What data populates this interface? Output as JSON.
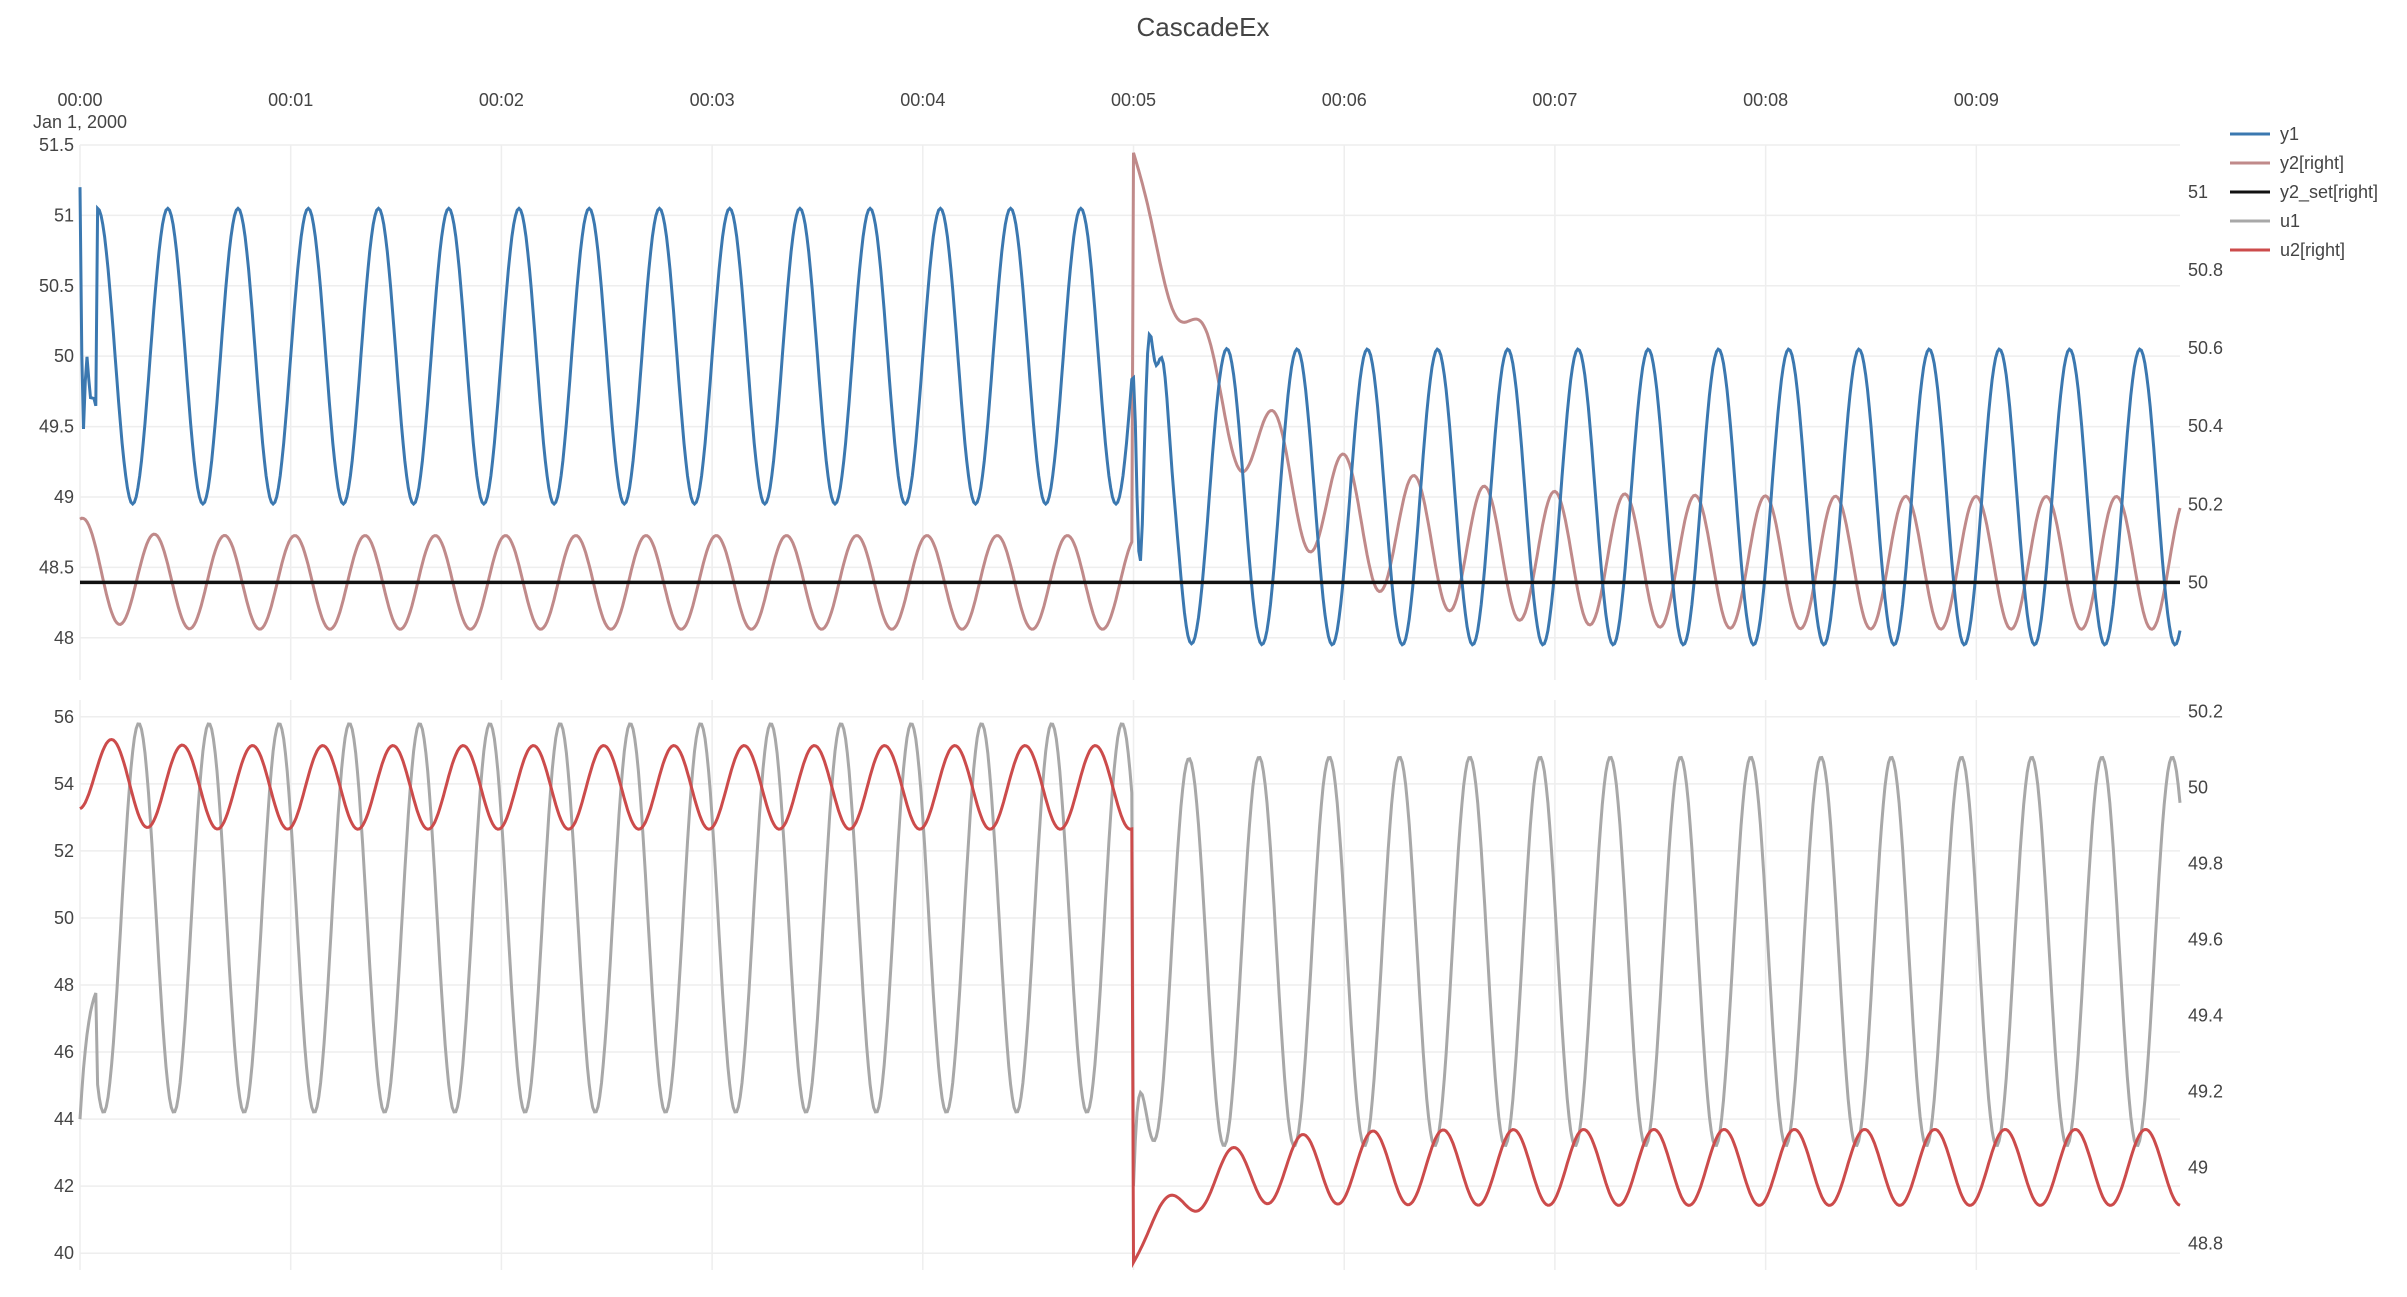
{
  "chart_data": {
    "type": "line",
    "title": "CascadeEx",
    "x_tick_labels": [
      "00:00",
      "00:01",
      "00:02",
      "00:03",
      "00:04",
      "00:05",
      "00:06",
      "00:07",
      "00:08",
      "00:09"
    ],
    "x_date_label": "Jan 1, 2000",
    "x_range_seconds": [
      0,
      598
    ],
    "grid": true,
    "legend_position": "top-right",
    "colors": {
      "y1": "#3b78b0",
      "y2": "#c08a8a",
      "y2_set": "#111111",
      "u1": "#a8a8a8",
      "u2": "#cc4b4b"
    },
    "series": [
      {
        "name": "y1",
        "subplot": "top",
        "axis": "left",
        "description": "oscillation ~49-51 before 00:05, ~48-50 after"
      },
      {
        "name": "y2[right]",
        "subplot": "top",
        "axis": "right",
        "description": "oscillation ~49.9-50.1 before 00:05, spike to 51.1 then decays"
      },
      {
        "name": "y2_set[right]",
        "subplot": "top",
        "axis": "right",
        "constant": 50
      },
      {
        "name": "u1",
        "subplot": "bottom",
        "axis": "left",
        "description": "oscillation ~44-56 before 00:05, ~43-55 after"
      },
      {
        "name": "u2[right]",
        "subplot": "bottom",
        "axis": "right",
        "description": "oscillation ~49.9-50.1 before 00:05, drops to ~48.9-49.1 after"
      }
    ],
    "subplots": [
      {
        "id": "top",
        "left_axis": {
          "range": [
            47.7,
            51.5
          ],
          "ticks": [
            "51.5",
            "51",
            "50.5",
            "50",
            "49.5",
            "49",
            "48.5",
            "48"
          ]
        },
        "right_axis": {
          "range": [
            49.75,
            51.12
          ],
          "ticks": [
            "51",
            "50.8",
            "50.6",
            "50.4",
            "50.2",
            "50"
          ]
        }
      },
      {
        "id": "bottom",
        "left_axis": {
          "range": [
            39.5,
            56.5
          ],
          "ticks": [
            "56",
            "54",
            "52",
            "50",
            "48",
            "46",
            "44",
            "42",
            "40"
          ]
        },
        "right_axis": {
          "range": [
            48.73,
            50.23
          ],
          "ticks": [
            "50.2",
            "50",
            "49.8",
            "49.6",
            "49.4",
            "49.2",
            "49",
            "48.8"
          ]
        }
      }
    ]
  }
}
